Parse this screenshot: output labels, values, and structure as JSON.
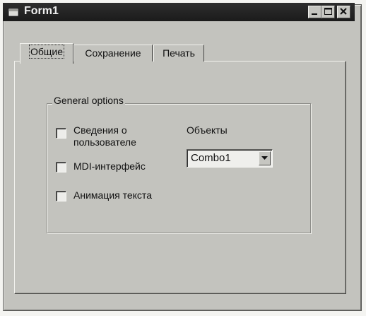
{
  "window": {
    "title": "Form1",
    "icons": {
      "app": "form-icon",
      "minimize": "minimize-icon",
      "maximize": "maximize-icon",
      "close": "close-icon"
    }
  },
  "tabs": [
    {
      "label": "Общие",
      "active": true
    },
    {
      "label": "Сохранение",
      "active": false
    },
    {
      "label": "Печать",
      "active": false
    }
  ],
  "group": {
    "title": "General options",
    "checkboxes": [
      {
        "label_line1": "Сведения о",
        "label_line2": "пользователе",
        "checked": false
      },
      {
        "label": "MDI-интерфейс",
        "checked": false
      },
      {
        "label": "Анимация текста",
        "checked": false
      }
    ],
    "objects_label": "Объекты",
    "combo": {
      "value": "Combo1",
      "icon": "chevron-down-icon"
    }
  },
  "colors": {
    "face": "#c3c3be",
    "titlebar": "#1f1f1f"
  }
}
